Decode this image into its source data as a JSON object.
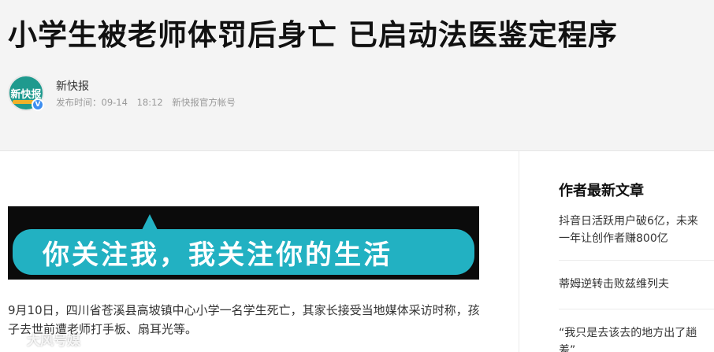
{
  "article": {
    "title": "小学生被老师体罚后身亡 已启动法医鉴定程序",
    "author": "新快报",
    "avatar_text": "新快报",
    "verified_badge": "V",
    "publish_label": "发布时间：",
    "publish_date": "09-14",
    "publish_time": "18:12",
    "account_type": "新快报官方帐号",
    "banner_text": "你关注我，我关注你的生活",
    "paragraph": "9月10日，四川省苍溪县高坡镇中心小学一名学生死亡，其家长接受当地媒体采访时称，孩子去世前遭老师打手板、扇耳光等。",
    "watermark": "大风号媒"
  },
  "sidebar": {
    "heading": "作者最新文章",
    "items": [
      {
        "label": "抖音日活跃用户破6亿，未来一年让创作者赚800亿"
      },
      {
        "label": "蒂姆逆转击败兹维列夫"
      },
      {
        "label": "“我只是去该去的地方出了趟差”"
      }
    ]
  },
  "colors": {
    "banner_bubble": "#22b1c2",
    "avatar_bg": "#1f9a8e",
    "verified": "#3d8ef0",
    "header_bg": "#f4f4f4"
  }
}
